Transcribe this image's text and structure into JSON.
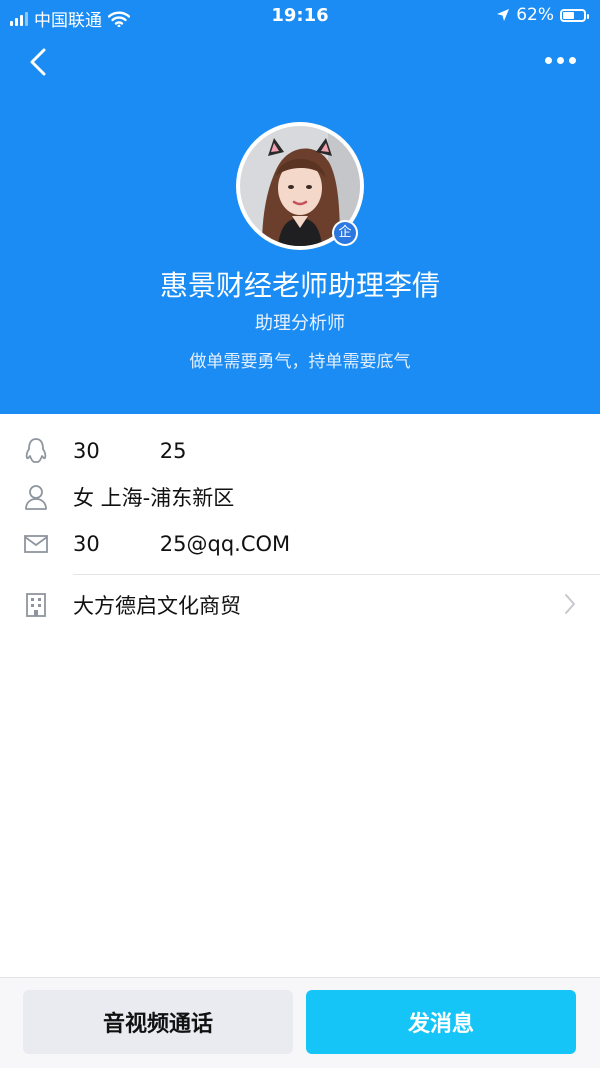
{
  "status_bar": {
    "carrier": "中国联通",
    "time": "19:16",
    "battery_percent": "62%",
    "battery_level": 0.62
  },
  "nav": {
    "back_icon": "chevron-left-icon",
    "more_icon": "more-horizontal-icon"
  },
  "profile": {
    "name": "惠景财经老师助理李倩",
    "title": "助理分析师",
    "signature": "做单需要勇气，持单需要底气",
    "enterprise_badge": "企"
  },
  "info": {
    "qq_number": "30         25",
    "gender_location": "女 上海-浦东新区",
    "email": "30         25@qq.COM",
    "company": "大方德启文化商贸"
  },
  "actions": {
    "call_label": "音视频通话",
    "message_label": "发消息"
  },
  "colors": {
    "header_blue": "#1b8cf3",
    "message_button": "#16c5f7",
    "call_button": "#e9ebf0",
    "badge_blue": "#2c78e0"
  }
}
